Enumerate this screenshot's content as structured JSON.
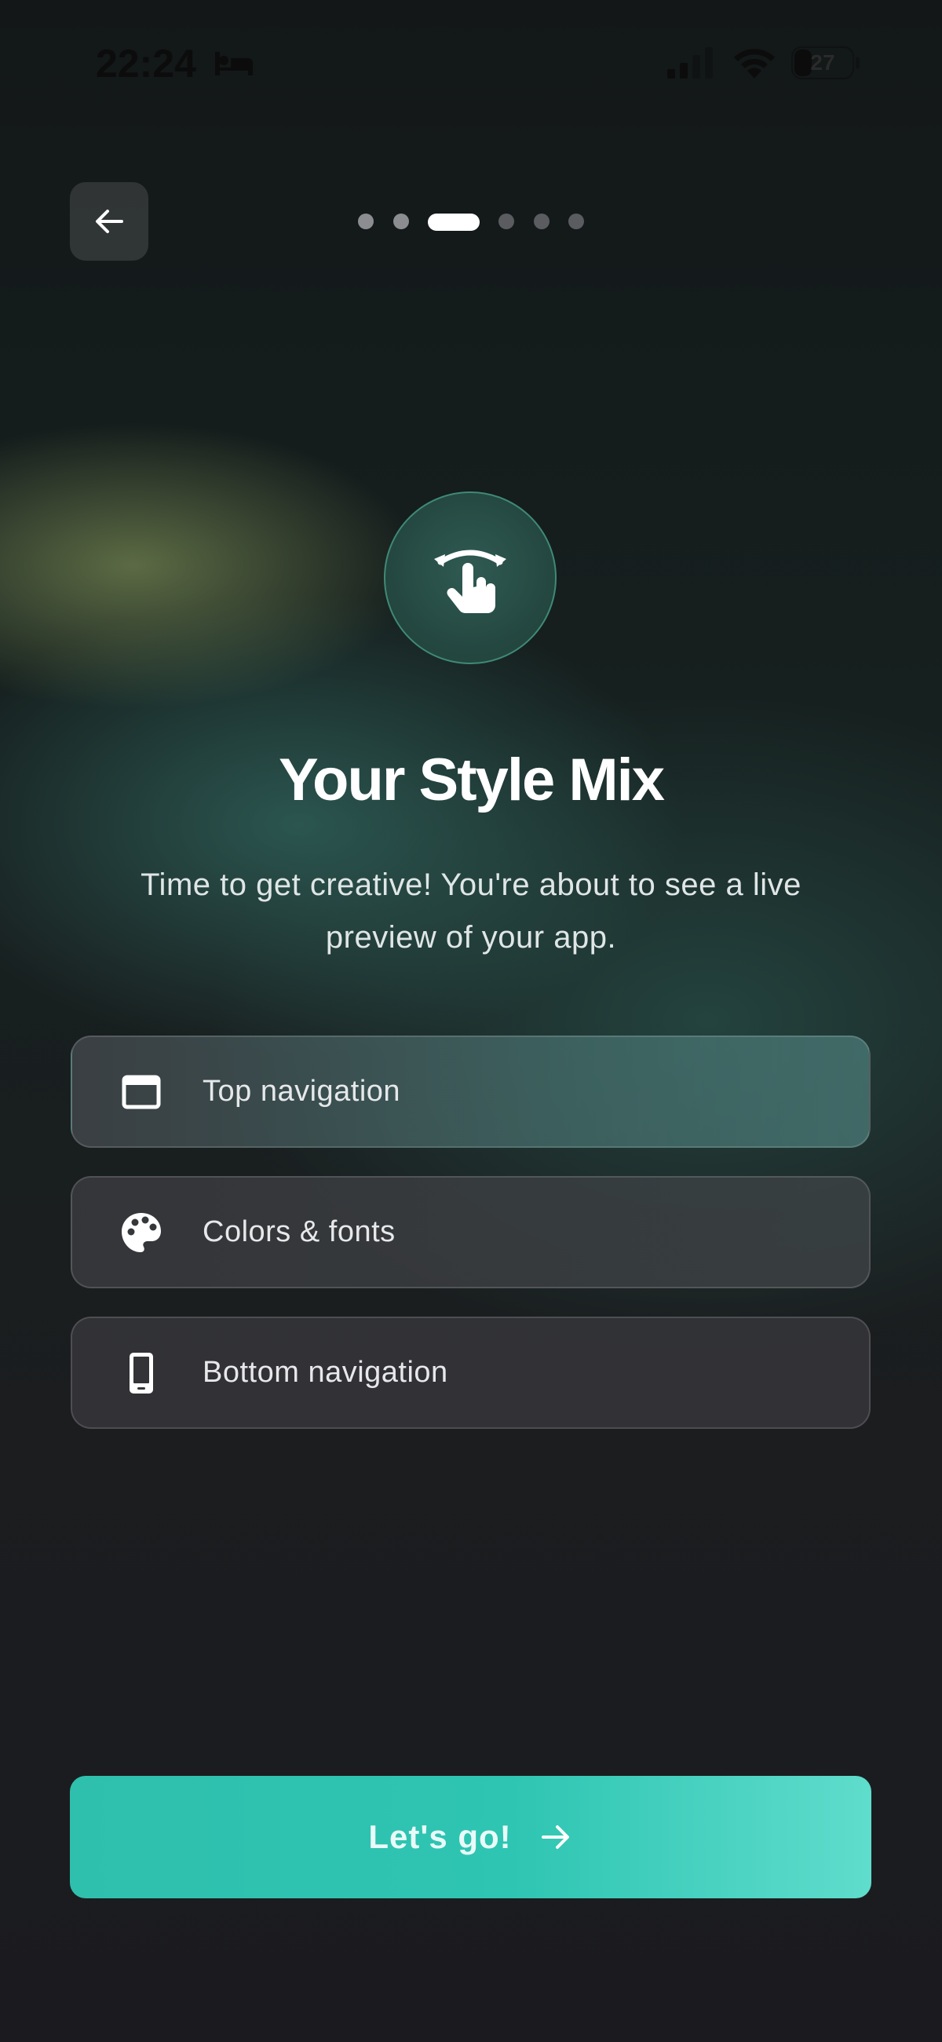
{
  "status_bar": {
    "time": "22:24",
    "battery": "27",
    "icons": [
      "bed-icon",
      "signal-icon",
      "wifi-icon",
      "battery-icon"
    ]
  },
  "header": {
    "back_icon": "arrow-left-icon",
    "progress": {
      "total_steps": 6,
      "current_step": 3
    }
  },
  "hero": {
    "icon": "swipe-gesture-icon",
    "title": "Your Style Mix",
    "subtitle": "Time to get creative! You're about to see a live preview of your app."
  },
  "options": [
    {
      "label": "Top navigation",
      "icon": "browser-window-icon"
    },
    {
      "label": "Colors & fonts",
      "icon": "palette-icon"
    },
    {
      "label": "Bottom navigation",
      "icon": "smartphone-icon"
    }
  ],
  "cta": {
    "label": "Let's go!",
    "icon": "arrow-right-icon"
  },
  "colors": {
    "background": "#1b1b1f",
    "accent": "#2ec5b2",
    "hero_border": "#3f8a76"
  }
}
